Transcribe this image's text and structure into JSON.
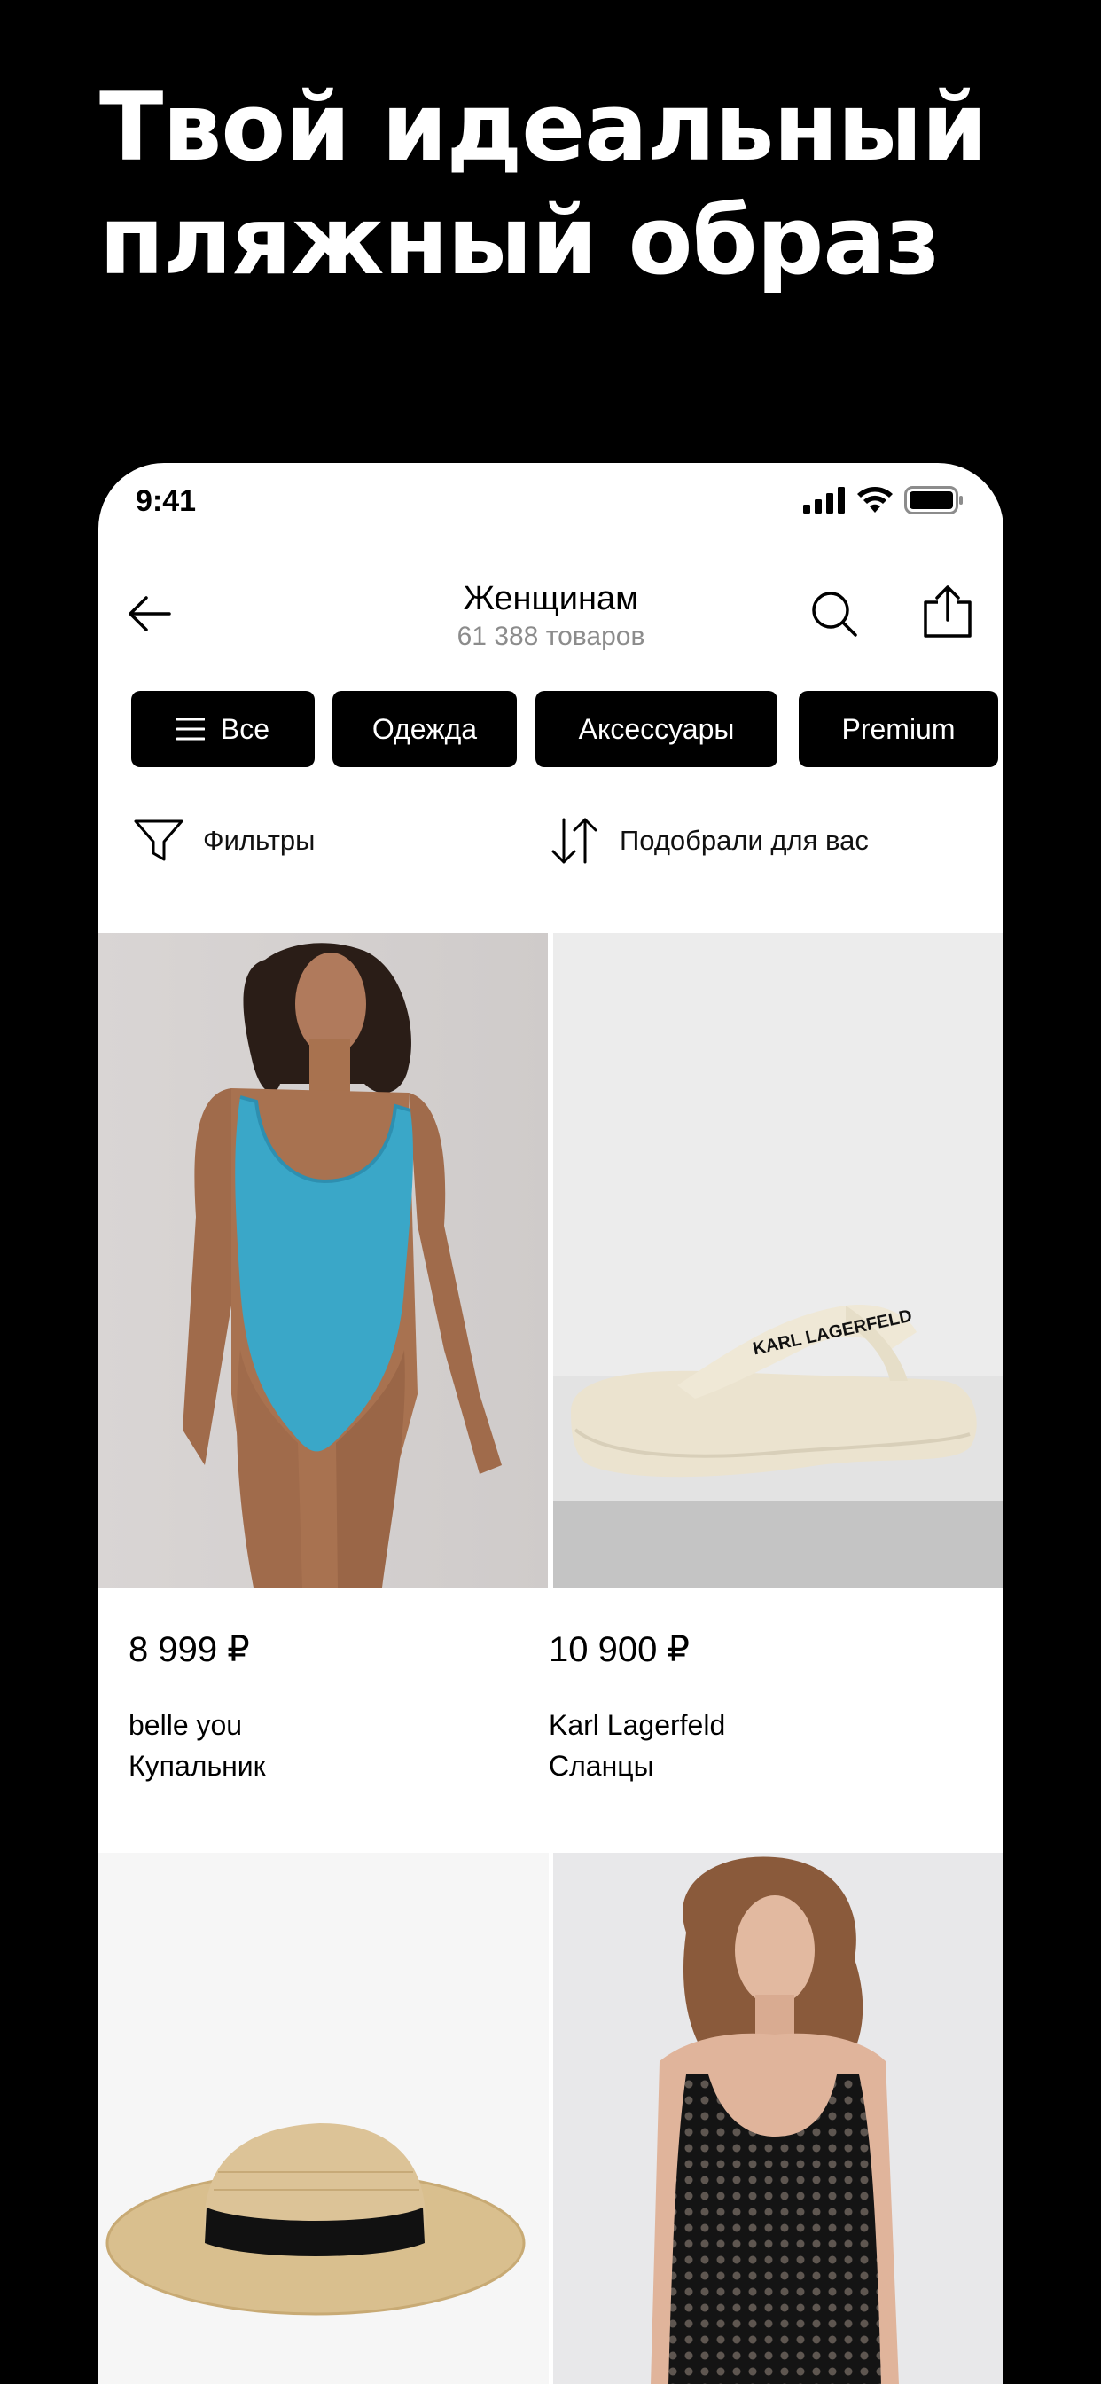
{
  "promo": {
    "headline_line1": "Твой идеальный",
    "headline_line2": "пляжный образ"
  },
  "status_bar": {
    "time": "9:41"
  },
  "nav": {
    "title": "Женщинам",
    "subtitle": "61 388 товаров"
  },
  "chips": [
    {
      "label": "Все",
      "icon": "menu-icon"
    },
    {
      "label": "Одежда"
    },
    {
      "label": "Аксессуары"
    },
    {
      "label": "Premium"
    }
  ],
  "tools": {
    "filters_label": "Фильтры",
    "sort_label": "Подобрали для вас"
  },
  "products": [
    {
      "price": "8 999 ₽",
      "brand": "belle you",
      "type": "Купальник",
      "image": "turquoise swimsuit"
    },
    {
      "price": "10 900 ₽",
      "brand": "Karl Lagerfeld",
      "type": "Сланцы",
      "image": "cream flip-flops",
      "print": "KARL LAGERFELD"
    },
    {
      "image": "straw hat"
    },
    {
      "image": "black crochet dress"
    }
  ],
  "colors": {
    "background": "#000000",
    "surface": "#ffffff",
    "chip_bg": "#000000",
    "muted_text": "#8c8c8c"
  }
}
